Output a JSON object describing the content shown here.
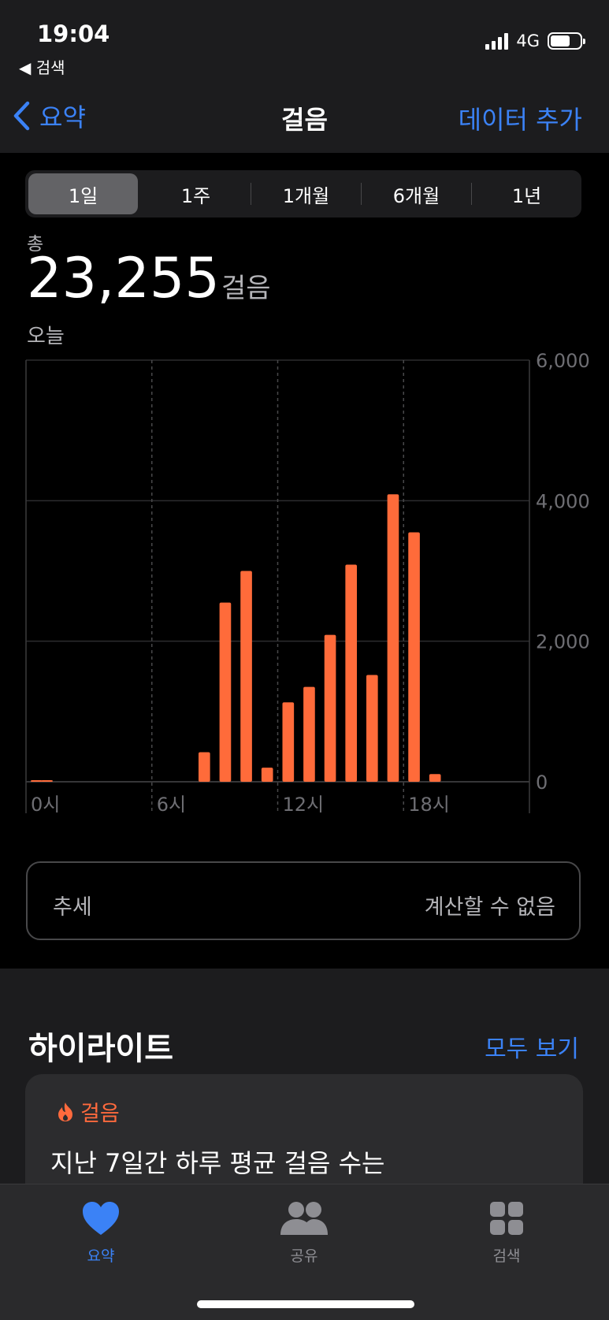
{
  "status": {
    "time": "19:04",
    "network": "4G",
    "back_app": "◀ 검색"
  },
  "nav": {
    "back_label": "요약",
    "title": "걸음",
    "add_label": "데이터 추가"
  },
  "segments": [
    "1일",
    "1주",
    "1개월",
    "6개월",
    "1년"
  ],
  "selected_segment": "1일",
  "summary": {
    "label": "총",
    "value": "23,255",
    "unit": "걸음",
    "date": "오늘"
  },
  "chart_data": {
    "type": "bar",
    "x_axis": {
      "unit": "hour",
      "range": [
        0,
        24
      ],
      "tick_values": [
        0,
        6,
        12,
        18
      ],
      "tick_labels": [
        "0시",
        "6시",
        "12시",
        "18시"
      ]
    },
    "y_axis": {
      "range": [
        0,
        6000
      ],
      "tick_values": [
        0,
        2000,
        4000,
        6000
      ],
      "tick_labels": [
        "0",
        "2,000",
        "4,000",
        "6,000"
      ],
      "position": "right"
    },
    "hours": [
      0,
      0.5,
      8,
      9,
      10,
      11,
      12,
      13,
      14,
      15,
      16,
      17,
      18,
      19
    ],
    "values": [
      10,
      10,
      420,
      2550,
      3000,
      200,
      1130,
      1350,
      2090,
      3090,
      1520,
      4090,
      3550,
      110
    ],
    "color": "#ff6b3a",
    "grid": true
  },
  "trend": {
    "label": "추세",
    "value": "계산할 수 없음"
  },
  "highlights": {
    "title": "하이라이트",
    "see_all": "모두 보기",
    "card": {
      "category": "걸음",
      "text": "지난 7일간 하루 평균 걸음 수는"
    }
  },
  "tabs": [
    {
      "label": "요약",
      "icon": "heart-icon",
      "active": true
    },
    {
      "label": "공유",
      "icon": "people-icon",
      "active": false
    },
    {
      "label": "검색",
      "icon": "grid-icon",
      "active": false
    }
  ],
  "colors": {
    "accent": "#3b82f6",
    "bar": "#ff6b3a",
    "highlight": "#ff6a3d"
  }
}
